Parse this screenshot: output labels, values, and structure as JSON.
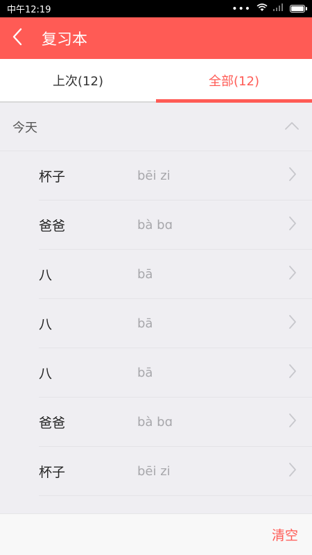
{
  "status_bar": {
    "time": "中午12:19",
    "signal_dots": "•••"
  },
  "app_bar": {
    "title": "复习本",
    "back_icon": "chevron-left-icon"
  },
  "tabs": [
    {
      "label": "上次(12)",
      "active": false
    },
    {
      "label": "全部(12)",
      "active": true
    }
  ],
  "section": {
    "title": "今天",
    "collapse_icon": "chevron-up-icon"
  },
  "items": [
    {
      "word": "杯子",
      "pinyin": "bēi zi"
    },
    {
      "word": "爸爸",
      "pinyin": "bà bɑ"
    },
    {
      "word": "八",
      "pinyin": "bā"
    },
    {
      "word": "八",
      "pinyin": "bā"
    },
    {
      "word": "八",
      "pinyin": "bā"
    },
    {
      "word": "爸爸",
      "pinyin": "bà bɑ"
    },
    {
      "word": "杯子",
      "pinyin": "bēi zi"
    }
  ],
  "bottom_bar": {
    "clear_label": "清空"
  },
  "colors": {
    "accent": "#ff5b55",
    "background": "#efeef2",
    "pinyin_text": "#a7a7ab"
  }
}
